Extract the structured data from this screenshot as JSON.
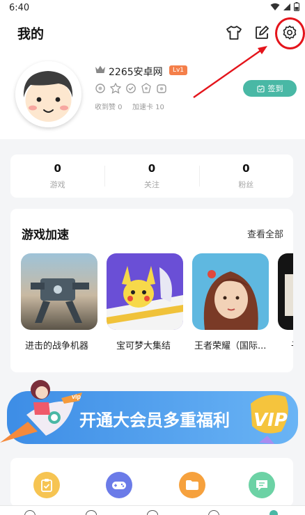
{
  "status_bar": {
    "time": "6:40"
  },
  "header": {
    "title": "我的"
  },
  "profile": {
    "username": "2265安卓网",
    "level": "Lv1",
    "received_likes": "收到赞 0",
    "boost_cards": "加速卡 10",
    "checkin_label": "签到"
  },
  "stats": [
    {
      "value": "0",
      "label": "游戏"
    },
    {
      "value": "0",
      "label": "关注"
    },
    {
      "value": "0",
      "label": "粉丝"
    }
  ],
  "game_section": {
    "title": "游戏加速",
    "view_all": "查看全部",
    "games": [
      {
        "name": "进击的战争机器"
      },
      {
        "name": "宝可梦大集结"
      },
      {
        "name": "王者荣耀（国际..."
      },
      {
        "name": "子"
      }
    ]
  },
  "vip_banner": {
    "badge": "vip",
    "text": "开通大会员多重福利",
    "logo": "VIP"
  },
  "colors": {
    "accent": "#49b8a5",
    "level_badge": "#f47f4a",
    "annotation_red": "#e4141b",
    "banner_blue": "#3a8ee8"
  },
  "icons": {
    "header": [
      "tshirt-icon",
      "edit-icon",
      "settings-icon"
    ],
    "tools": [
      "clipboard-icon",
      "gamepad-icon",
      "folder-icon",
      "chat-icon"
    ]
  }
}
